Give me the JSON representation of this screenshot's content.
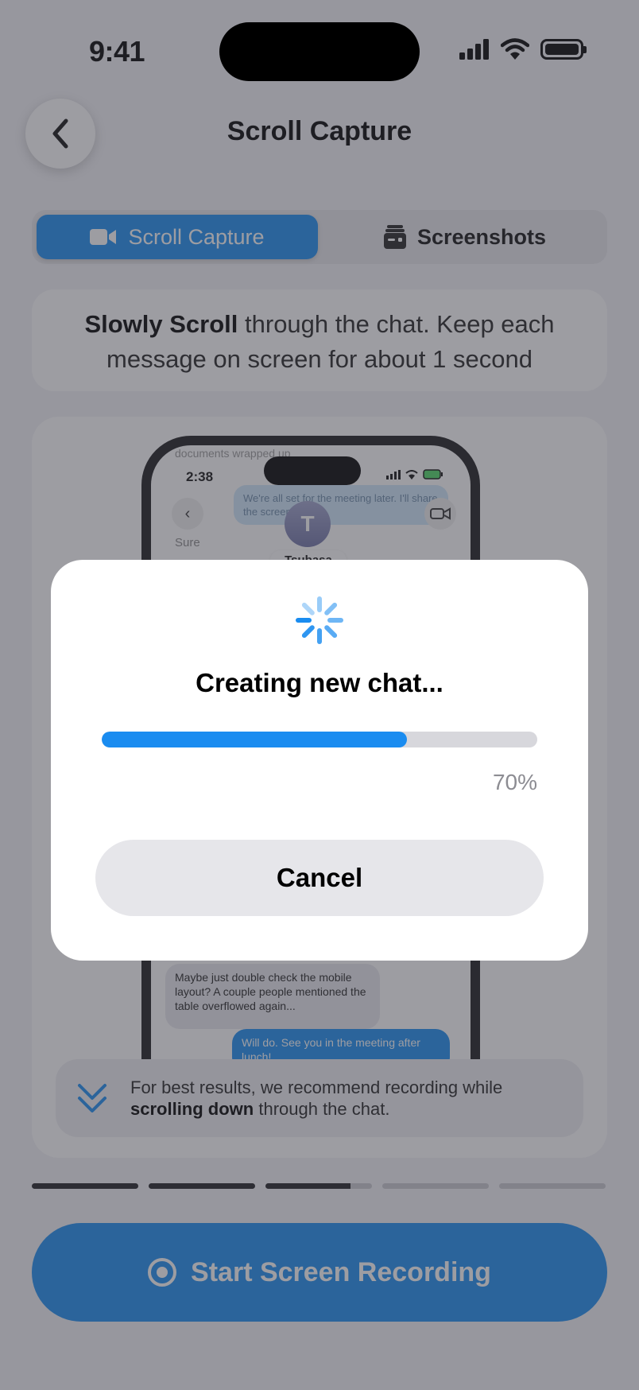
{
  "status_bar": {
    "time": "9:41",
    "icons": [
      "cellular-signal-icon",
      "wifi-icon",
      "battery-icon"
    ]
  },
  "header": {
    "title": "Scroll Capture",
    "back_icon": "chevron-left-icon"
  },
  "segmented": {
    "tabs": [
      {
        "label": "Scroll Capture",
        "icon": "video-camera-icon",
        "selected": true
      },
      {
        "label": "Screenshots",
        "icon": "screenshot-stack-icon",
        "selected": false
      }
    ]
  },
  "instructions": {
    "bold": "Slowly Scroll",
    "rest": " through the chat. Keep each message on screen for about 1 second"
  },
  "preview": {
    "time": "2:38",
    "faded_top_text": "documents wrapped up",
    "top_bubble": "We're all set for the meeting later. I'll share the screen then...",
    "contact_initial": "T",
    "contact_name": "Tsubasa",
    "sure_text": "Sure",
    "gray_bubble": "Maybe just double check the mobile layout? A couple people mentioned the table overflowed again...",
    "blue_bubble": "Will do. See you in the meeting after lunch!"
  },
  "tip": {
    "line1": "For best results, we recommend recording while",
    "bold": "scrolling down",
    "rest": " through the chat.",
    "icon": "double-chevron-down-icon"
  },
  "steps": {
    "total": 5,
    "completed": 2,
    "current_progress": 0.8
  },
  "start_button": {
    "label": "Start Screen Recording",
    "icon": "record-icon"
  },
  "modal": {
    "title": "Creating new chat...",
    "progress": 0.7,
    "percent_text": "70%",
    "cancel_label": "Cancel",
    "spinner_icon": "activity-spinner-icon"
  },
  "colors": {
    "accent": "#1a8cf0",
    "track": "#d7d7dc",
    "dim_overlay": "rgba(60,60,70,0.50)"
  }
}
